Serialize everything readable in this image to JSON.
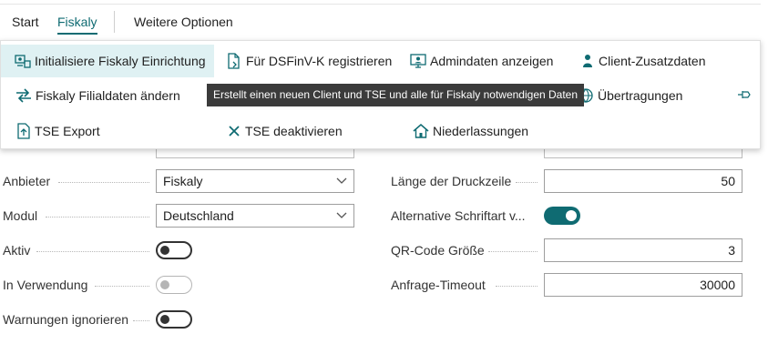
{
  "tabs": {
    "start": "Start",
    "fiskaly": "Fiskaly",
    "more": "Weitere Optionen"
  },
  "menu": {
    "init": "Initialisiere Fiskaly Einrichtung",
    "dsfinv": "Für DSFinV-K registrieren",
    "admin": "Admindaten anzeigen",
    "client": "Client-Zusatzdaten",
    "filial": "Fiskaly Filialdaten ändern",
    "transfer": "Übertragungen",
    "tse_export": "TSE Export",
    "tse_deact": "TSE deaktivieren",
    "branches": "Niederlassungen"
  },
  "tooltip": "Erstellt einen neuen Client und TSE und alle für Fiskaly notwendigen Daten",
  "form": {
    "left": {
      "anbieter": {
        "label": "Anbieter",
        "value": "Fiskaly"
      },
      "modul": {
        "label": "Modul",
        "value": "Deutschland"
      },
      "aktiv": {
        "label": "Aktiv",
        "state": "off"
      },
      "in_use": {
        "label": "In Verwendung",
        "state": "disabled"
      },
      "warn": {
        "label": "Warnungen ignorieren",
        "state": "off"
      }
    },
    "right": {
      "line_len": {
        "label": "Länge der Druckzeile",
        "value": "50"
      },
      "alt_font": {
        "label": "Alternative Schriftart v...",
        "state": "on"
      },
      "qr": {
        "label": "QR-Code Größe",
        "value": "3"
      },
      "timeout": {
        "label": "Anfrage-Timeout",
        "value": "30000"
      }
    }
  },
  "colors": {
    "accent": "#0f6b72",
    "highlight": "#dff1f3",
    "tooltip_bg": "#3b3b3b"
  }
}
